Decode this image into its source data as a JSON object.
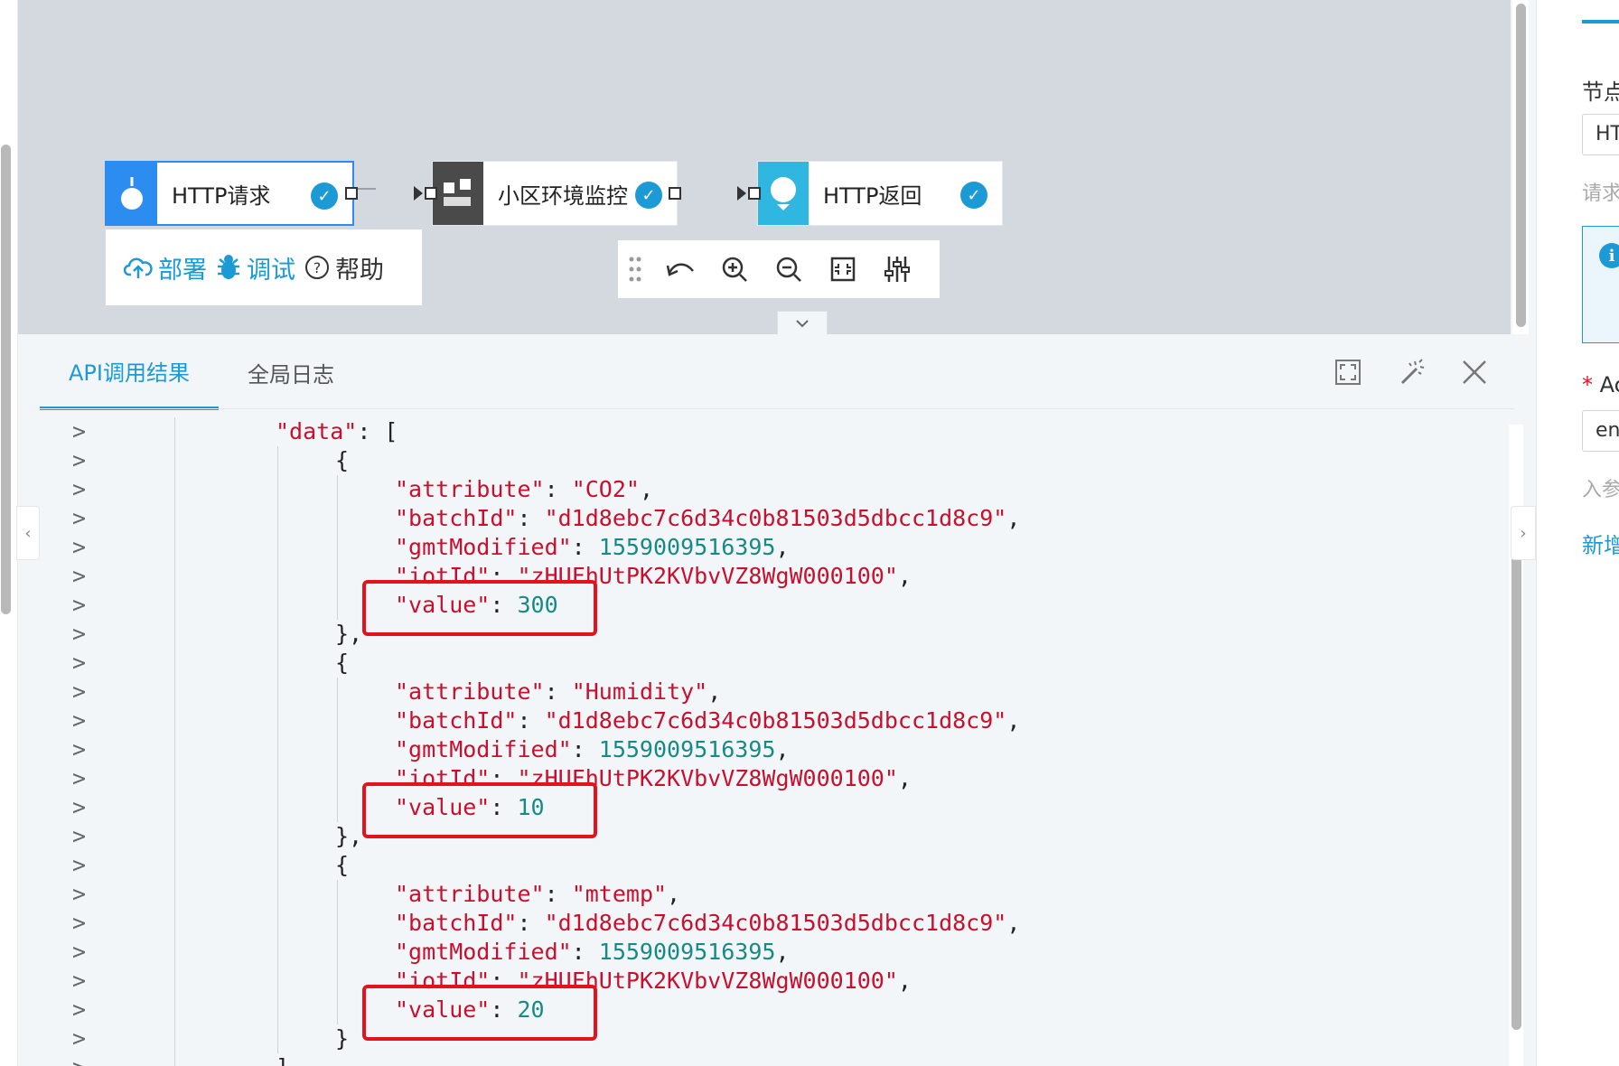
{
  "canvas": {
    "nodes": [
      {
        "label": "HTTP请求",
        "icon": "drop-icon"
      },
      {
        "label": "小区环境监控",
        "icon": "blocks-icon"
      },
      {
        "label": "HTTP返回",
        "icon": "bulb-icon"
      }
    ],
    "actions": {
      "deploy": "部署",
      "debug": "调试",
      "help": "帮助"
    }
  },
  "panel": {
    "tabs": [
      {
        "label": "API调用结果",
        "active": true
      },
      {
        "label": "全局日志",
        "active": false
      }
    ]
  },
  "json_output": {
    "lines": [
      {
        "indent": 5,
        "parts": [
          [
            "k",
            "\"data\""
          ],
          [
            "p",
            ": ["
          ]
        ]
      },
      {
        "indent": 7,
        "parts": [
          [
            "p",
            "{"
          ]
        ]
      },
      {
        "indent": 9,
        "parts": [
          [
            "k",
            "\"attribute\""
          ],
          [
            "p",
            ": "
          ],
          [
            "s",
            "\"CO2\""
          ],
          [
            "p",
            ","
          ]
        ]
      },
      {
        "indent": 9,
        "parts": [
          [
            "k",
            "\"batchId\""
          ],
          [
            "p",
            ": "
          ],
          [
            "s",
            "\"d1d8ebc7c6d34c0b81503d5dbcc1d8c9\""
          ],
          [
            "p",
            ","
          ]
        ]
      },
      {
        "indent": 9,
        "parts": [
          [
            "k",
            "\"gmtModified\""
          ],
          [
            "p",
            ": "
          ],
          [
            "n",
            "1559009516395"
          ],
          [
            "p",
            ","
          ]
        ]
      },
      {
        "indent": 9,
        "parts": [
          [
            "k",
            "\"iotId\""
          ],
          [
            "p",
            ": "
          ],
          [
            "s",
            "\"zHUFhUtPK2KVbvVZ8WgW000100\""
          ],
          [
            "p",
            ","
          ]
        ]
      },
      {
        "indent": 9,
        "parts": [
          [
            "k",
            "\"value\""
          ],
          [
            "p",
            ": "
          ],
          [
            "n",
            "300"
          ]
        ]
      },
      {
        "indent": 7,
        "parts": [
          [
            "p",
            "},"
          ]
        ]
      },
      {
        "indent": 7,
        "parts": [
          [
            "p",
            "{"
          ]
        ]
      },
      {
        "indent": 9,
        "parts": [
          [
            "k",
            "\"attribute\""
          ],
          [
            "p",
            ": "
          ],
          [
            "s",
            "\"Humidity\""
          ],
          [
            "p",
            ","
          ]
        ]
      },
      {
        "indent": 9,
        "parts": [
          [
            "k",
            "\"batchId\""
          ],
          [
            "p",
            ": "
          ],
          [
            "s",
            "\"d1d8ebc7c6d34c0b81503d5dbcc1d8c9\""
          ],
          [
            "p",
            ","
          ]
        ]
      },
      {
        "indent": 9,
        "parts": [
          [
            "k",
            "\"gmtModified\""
          ],
          [
            "p",
            ": "
          ],
          [
            "n",
            "1559009516395"
          ],
          [
            "p",
            ","
          ]
        ]
      },
      {
        "indent": 9,
        "parts": [
          [
            "k",
            "\"iotId\""
          ],
          [
            "p",
            ": "
          ],
          [
            "s",
            "\"zHUFhUtPK2KVbvVZ8WgW000100\""
          ],
          [
            "p",
            ","
          ]
        ]
      },
      {
        "indent": 9,
        "parts": [
          [
            "k",
            "\"value\""
          ],
          [
            "p",
            ": "
          ],
          [
            "n",
            "10"
          ]
        ]
      },
      {
        "indent": 7,
        "parts": [
          [
            "p",
            "},"
          ]
        ]
      },
      {
        "indent": 7,
        "parts": [
          [
            "p",
            "{"
          ]
        ]
      },
      {
        "indent": 9,
        "parts": [
          [
            "k",
            "\"attribute\""
          ],
          [
            "p",
            ": "
          ],
          [
            "s",
            "\"mtemp\""
          ],
          [
            "p",
            ","
          ]
        ]
      },
      {
        "indent": 9,
        "parts": [
          [
            "k",
            "\"batchId\""
          ],
          [
            "p",
            ": "
          ],
          [
            "s",
            "\"d1d8ebc7c6d34c0b81503d5dbcc1d8c9\""
          ],
          [
            "p",
            ","
          ]
        ]
      },
      {
        "indent": 9,
        "parts": [
          [
            "k",
            "\"gmtModified\""
          ],
          [
            "p",
            ": "
          ],
          [
            "n",
            "1559009516395"
          ],
          [
            "p",
            ","
          ]
        ]
      },
      {
        "indent": 9,
        "parts": [
          [
            "k",
            "\"iotId\""
          ],
          [
            "p",
            ": "
          ],
          [
            "s",
            "\"zHUFhUtPK2KVbvVZ8WgW000100\""
          ],
          [
            "p",
            ","
          ]
        ]
      },
      {
        "indent": 9,
        "parts": [
          [
            "k",
            "\"value\""
          ],
          [
            "p",
            ": "
          ],
          [
            "n",
            "20"
          ]
        ]
      },
      {
        "indent": 7,
        "parts": [
          [
            "p",
            "}"
          ]
        ]
      },
      {
        "indent": 5,
        "parts": [
          [
            "p",
            "]"
          ]
        ]
      }
    ],
    "gutter_symbol": ">"
  },
  "right_panel": {
    "node_label": "节点",
    "node_input": "HT",
    "request_label": "请求",
    "required_label": "Ac",
    "required_input": "en",
    "params_label": "入参",
    "add_link": "新增"
  },
  "colors": {
    "accent": "#1b9ad6",
    "highlight": "#e3121d",
    "key": "#c8102e",
    "number": "#178a86"
  }
}
